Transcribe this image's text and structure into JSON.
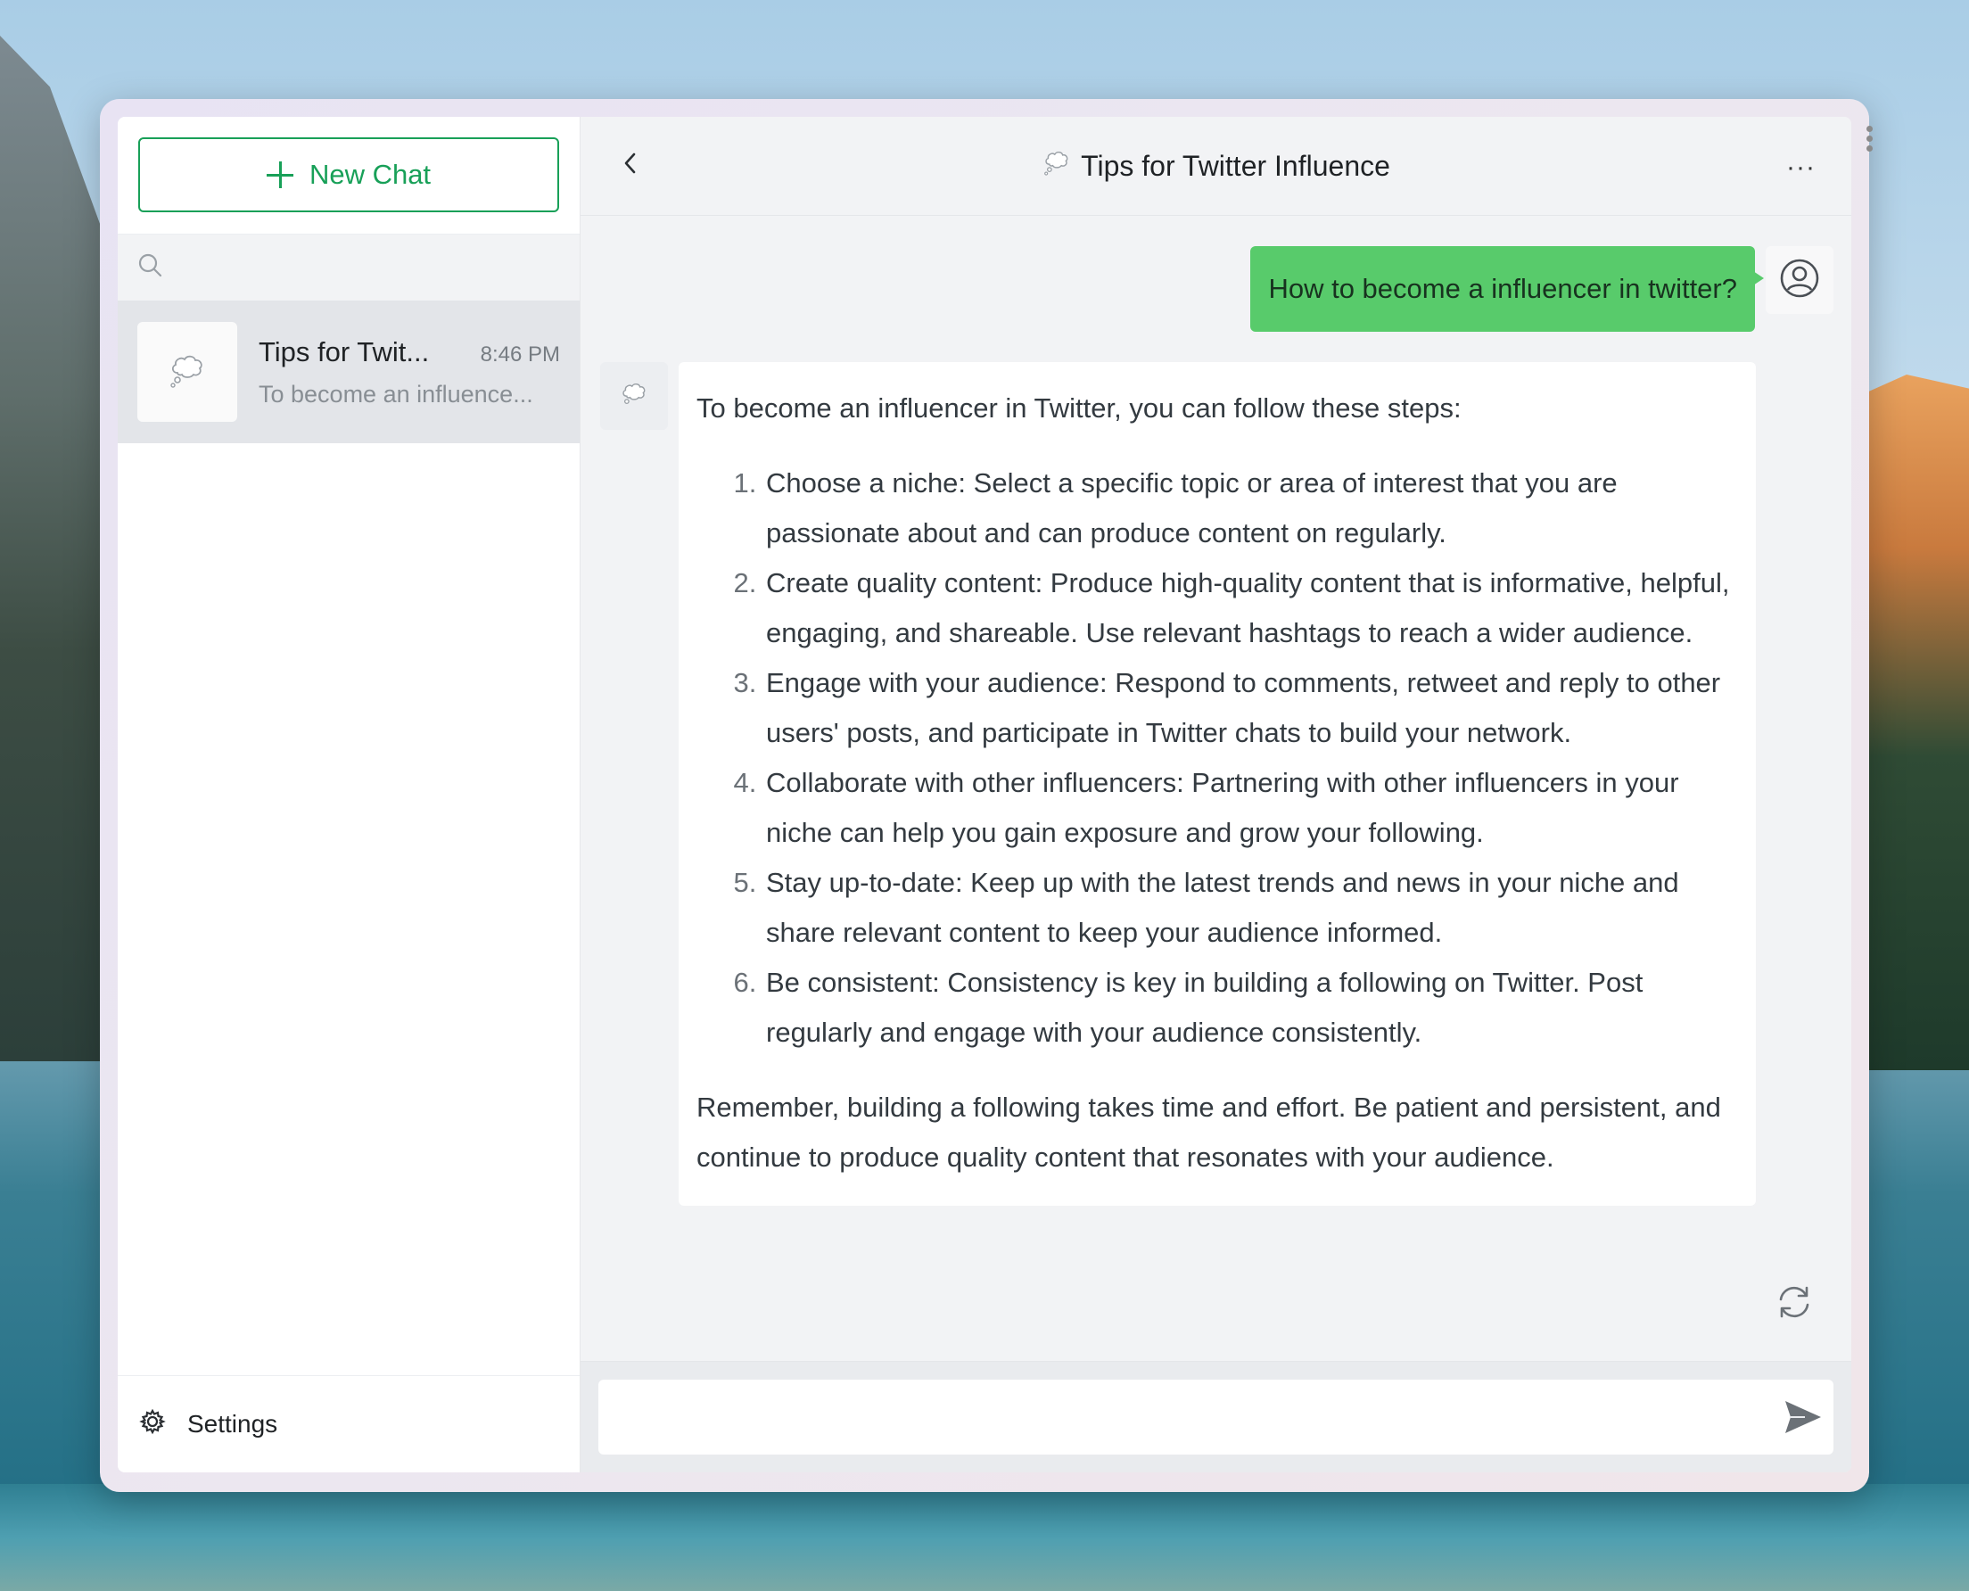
{
  "sidebar": {
    "new_chat_label": "New Chat",
    "search_placeholder": "",
    "conversations": [
      {
        "title": "Tips for Twit...",
        "time": "8:46 PM",
        "preview": "To become an influence..."
      }
    ],
    "settings_label": "Settings"
  },
  "header": {
    "title": "Tips for Twitter Influence",
    "more_label": "···"
  },
  "messages": {
    "user": "How to become a influencer in twitter?",
    "bot": {
      "intro": "To become an influencer in Twitter, you can follow these steps:",
      "steps": [
        "Choose a niche: Select a specific topic or area of interest that you are passionate about and can produce content on regularly.",
        "Create quality content: Produce high-quality content that is informative, helpful, engaging, and shareable. Use relevant hashtags to reach a wider audience.",
        "Engage with your audience: Respond to comments, retweet and reply to other users' posts, and participate in Twitter chats to build your network.",
        "Collaborate with other influencers: Partnering with other influencers in your niche can help you gain exposure and grow your following.",
        "Stay up-to-date: Keep up with the latest trends and news in your niche and share relevant content to keep your audience informed.",
        "Be consistent: Consistency is key in building a following on Twitter. Post regularly and engage with your audience consistently."
      ],
      "outro": "Remember, building a following takes time and effort. Be patient and persistent, and continue to produce quality content that resonates with your audience."
    }
  },
  "input": {
    "value": "",
    "placeholder": ""
  },
  "colors": {
    "accent": "#18a058",
    "user_bubble": "#58cb6b"
  },
  "icons": [
    "plus-icon",
    "search-icon",
    "thought-bubble-icon",
    "gear-icon",
    "back-chevron-icon",
    "more-icon",
    "user-avatar-icon",
    "refresh-icon",
    "send-icon"
  ]
}
